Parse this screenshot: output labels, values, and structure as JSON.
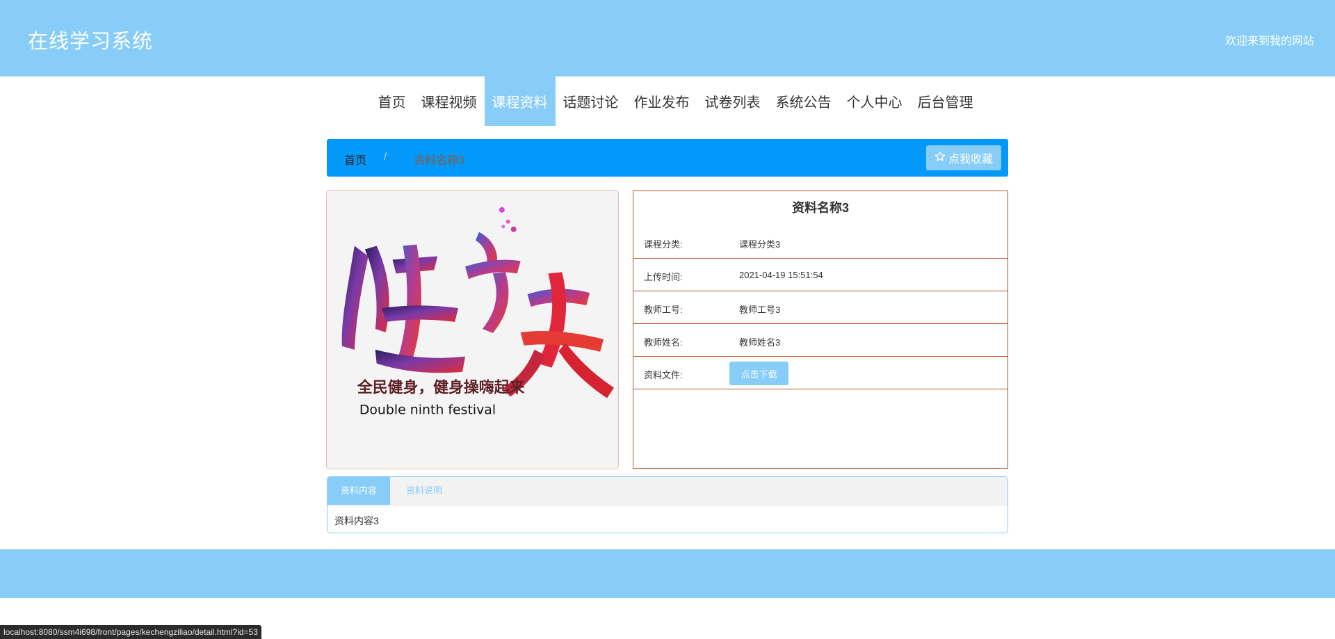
{
  "header": {
    "site_title": "在线学习系统",
    "welcome": "欢迎来到我的网站"
  },
  "nav": {
    "items": [
      {
        "label": "首页"
      },
      {
        "label": "课程视频"
      },
      {
        "label": "课程资料",
        "active": true
      },
      {
        "label": "话题讨论"
      },
      {
        "label": "作业发布"
      },
      {
        "label": "试卷列表"
      },
      {
        "label": "系统公告"
      },
      {
        "label": "个人中心"
      },
      {
        "label": "后台管理"
      }
    ]
  },
  "breadcrumb": {
    "home": "首页",
    "separator": "/",
    "current": "资料名称3",
    "favorite_label": "点我收藏",
    "favorite_icon": "star-outline-icon"
  },
  "image": {
    "slogan_cn": "全民健身，健身操嗨起来",
    "slogan_en": "Double ninth festival"
  },
  "detail": {
    "title": "资料名称3",
    "rows": [
      {
        "label": "课程分类:",
        "value": "课程分类3"
      },
      {
        "label": "上传时间:",
        "value": "2021-04-19 15:51:54"
      },
      {
        "label": "教师工号:",
        "value": "教师工号3"
      },
      {
        "label": "教师姓名:",
        "value": "教师姓名3"
      }
    ],
    "file_label": "资料文件:",
    "download_label": "点击下载"
  },
  "tabs": {
    "items": [
      {
        "label": "资料内容",
        "active": true
      },
      {
        "label": "资料说明",
        "active": false
      }
    ],
    "content": "资料内容3"
  },
  "status_bar": {
    "url": "localhost:8080/ssm4i698/front/pages/kechengziliao/detail.html?id=53"
  },
  "colors": {
    "header": "#87cdf8",
    "breadcrumb_bar": "#0399fb",
    "detail_border": "#b5532c"
  }
}
